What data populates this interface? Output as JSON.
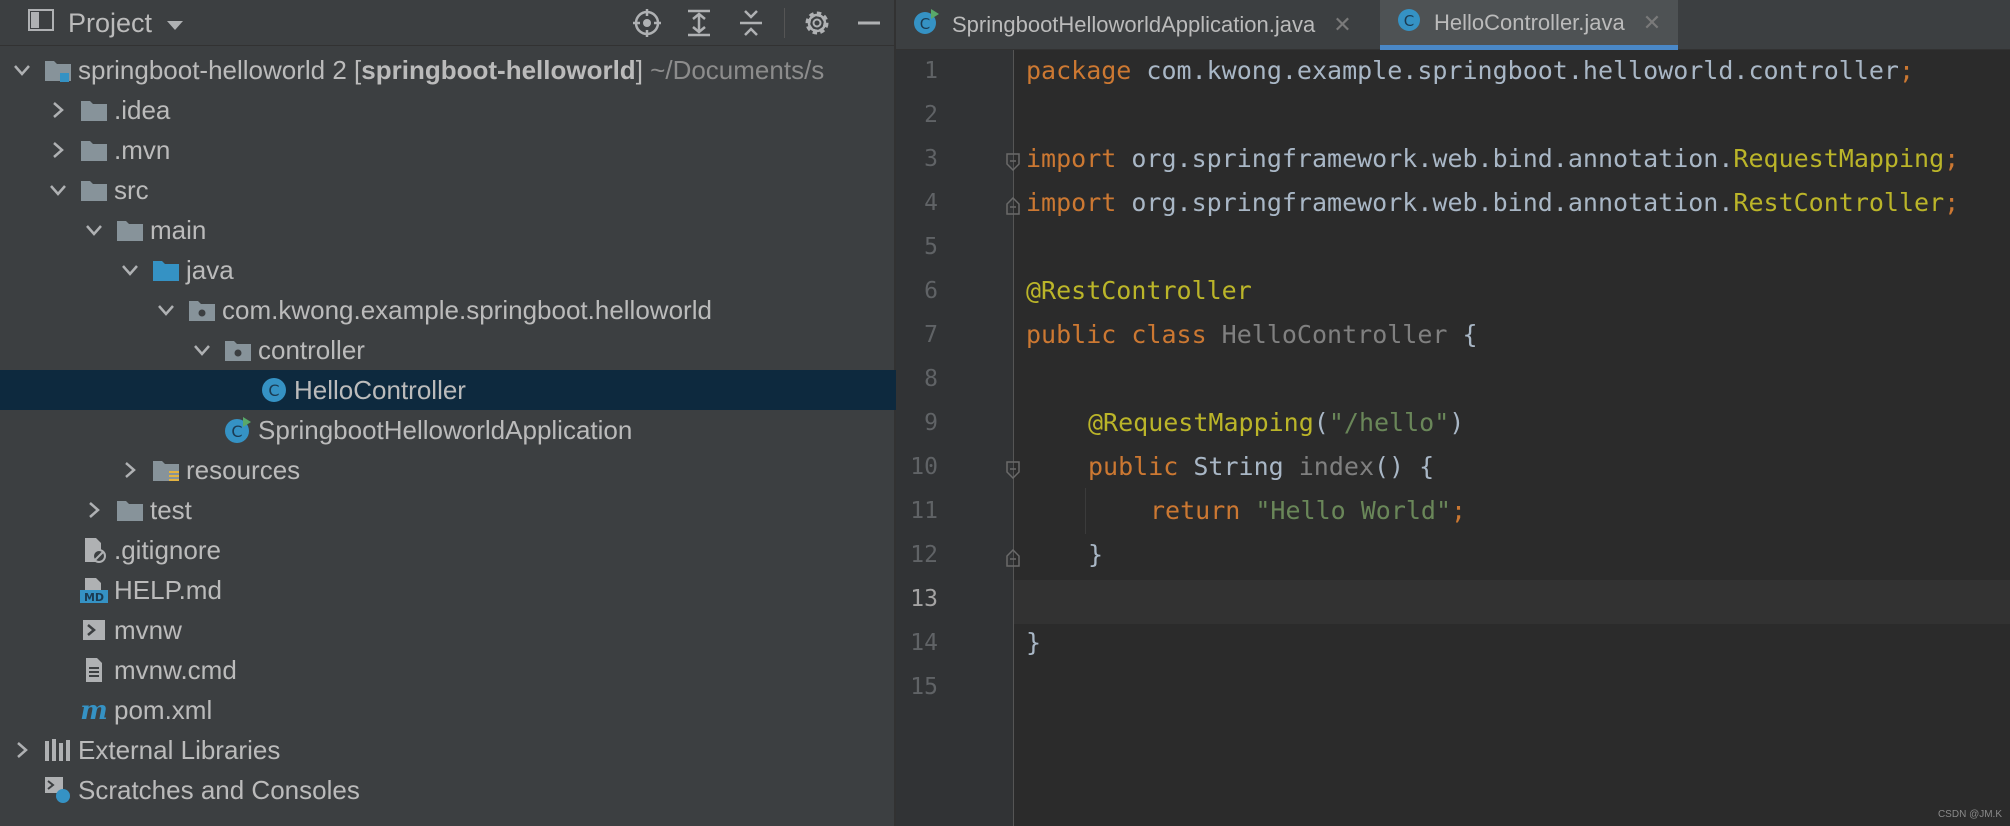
{
  "project_panel": {
    "title": "Project",
    "toolbar": {
      "locate": "target-icon",
      "expand_all": "expand-all-icon",
      "collapse_all": "collapse-all-icon",
      "settings": "gear-icon",
      "hide": "minimize-icon"
    },
    "tree": [
      {
        "label": "springboot-helloworld 2 [",
        "bold": "springboot-helloworld",
        "label_end": "]",
        "path": " ~/Documents/s",
        "expanded": true
      },
      {
        "label": ".idea",
        "expanded": false
      },
      {
        "label": ".mvn",
        "expanded": false
      },
      {
        "label": "src",
        "expanded": true
      },
      {
        "label": "main",
        "expanded": true
      },
      {
        "label": "java",
        "expanded": true
      },
      {
        "label": "com.kwong.example.springboot.helloworld",
        "expanded": true
      },
      {
        "label": "controller",
        "expanded": true
      },
      {
        "label": "HelloController",
        "selected": true
      },
      {
        "label": "SpringbootHelloworldApplication"
      },
      {
        "label": "resources",
        "expanded": false
      },
      {
        "label": "test",
        "expanded": false
      },
      {
        "label": ".gitignore"
      },
      {
        "label": "HELP.md"
      },
      {
        "label": "mvnw"
      },
      {
        "label": "mvnw.cmd"
      },
      {
        "label": "pom.xml"
      },
      {
        "label": "External Libraries",
        "expanded": false
      },
      {
        "label": "Scratches and Consoles"
      }
    ]
  },
  "editor": {
    "tabs": [
      {
        "label": "SpringbootHelloworldApplication.java",
        "active": false
      },
      {
        "label": "HelloController.java",
        "active": true
      }
    ],
    "line_numbers": [
      "1",
      "2",
      "3",
      "4",
      "5",
      "6",
      "7",
      "8",
      "9",
      "10",
      "11",
      "12",
      "13",
      "14",
      "15"
    ],
    "current_line": "13",
    "code": {
      "l1_kw": "package",
      "l1_rest": " com.kwong.example.springboot.helloworld.controller",
      "l1_semi": ";",
      "l3_kw": "import",
      "l3_pkg": " org.springframework.web.bind.annotation.",
      "l3_cls": "RequestMapping",
      "l3_semi": ";",
      "l4_kw": "import",
      "l4_pkg": " org.springframework.web.bind.annotation.",
      "l4_cls": "RestController",
      "l4_semi": ";",
      "l6_ann": "@RestController",
      "l7_kw": "public class",
      "l7_cls": " HelloController",
      "l7_brace": " {",
      "l9_ann": "@RequestMapping",
      "l9_p1": "(",
      "l9_str": "\"/hello\"",
      "l9_p2": ")",
      "l10_kw": "public",
      "l10_type": " String ",
      "l10_mth": "index",
      "l10_rest": "() {",
      "l11_kw": "return",
      "l11_str": " \"Hello World\"",
      "l11_semi": ";",
      "l12": "}",
      "l14": "}"
    }
  },
  "watermark": "CSDN @JM.K",
  "colors": {
    "keyword": "#cc7832",
    "annotation": "#bbb529",
    "string": "#6a8759",
    "text": "#a9b7c6",
    "selection": "#0d293e",
    "accent": "#4a88c7"
  }
}
